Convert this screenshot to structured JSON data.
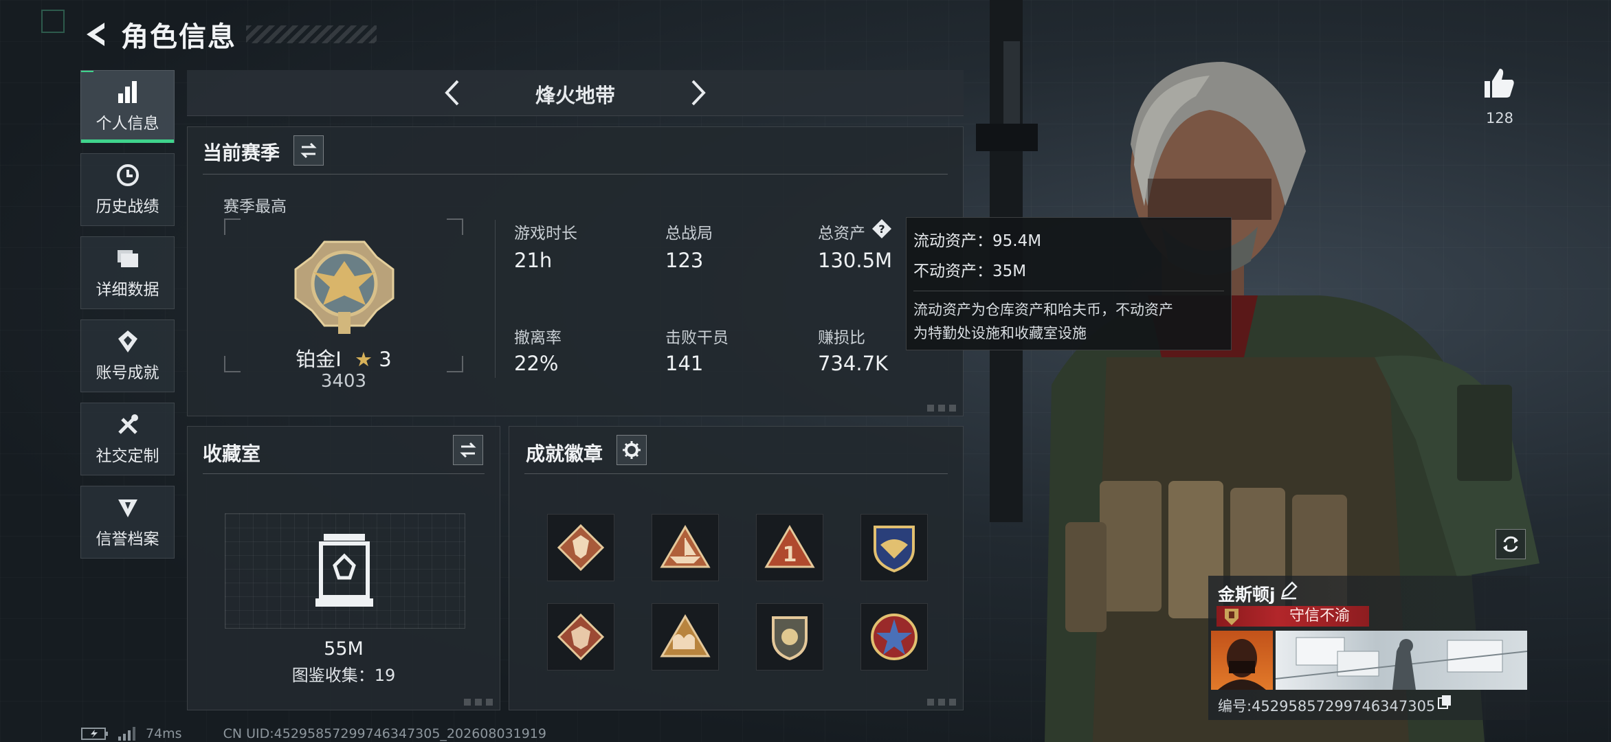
{
  "header": {
    "title": "角色信息"
  },
  "sidebar": {
    "items": [
      {
        "label": "个人信息",
        "icon": "bar-chart-icon",
        "active": true
      },
      {
        "label": "历史战绩",
        "icon": "history-clock-icon",
        "active": false
      },
      {
        "label": "详细数据",
        "icon": "folder-icon",
        "active": false
      },
      {
        "label": "账号成就",
        "icon": "achievement-icon",
        "active": false
      },
      {
        "label": "社交定制",
        "icon": "tools-icon",
        "active": false
      },
      {
        "label": "信誉档案",
        "icon": "credit-shield-icon",
        "active": false
      }
    ]
  },
  "mode": {
    "title": "烽火地带"
  },
  "season": {
    "title": "当前赛季",
    "highest_label": "赛季最高",
    "rank_name": "铂金Ⅰ",
    "rank_stars": "3",
    "rank_score": "3403",
    "stats": [
      {
        "label": "游戏时长",
        "value": "21h"
      },
      {
        "label": "总战局",
        "value": "123"
      },
      {
        "label": "总资产",
        "value": "130.5M"
      },
      {
        "label": "撤离率",
        "value": "22%"
      },
      {
        "label": "击败干员",
        "value": "141"
      },
      {
        "label": "赚损比",
        "value": "734.7K"
      }
    ]
  },
  "tooltip": {
    "liquid": "流动资产：95.4M",
    "fixed": "不动资产：35M",
    "desc_line1": "流动资产为仓库资产和哈夫币，不动资产",
    "desc_line2": "为特勤处设施和收藏室设施"
  },
  "collection": {
    "title": "收藏室",
    "value": "55M",
    "catalog": "图鉴收集：19"
  },
  "badges": {
    "title": "成就徽章",
    "items": [
      "wolf-badge-icon",
      "boat-badge-icon",
      "number-one-badge-icon",
      "eagle-shield-badge-icon",
      "dragon-badge-icon",
      "camel-badge-icon",
      "shield-badge-icon",
      "star-cross-badge-icon"
    ]
  },
  "player": {
    "likes": "128",
    "name": "金斯顿j",
    "title_badge": "守信不渝",
    "id": "编号:4529585729974634730​5"
  },
  "footer": {
    "ping": "74ms",
    "uid": "CN UID:452958572997463473​05_202608031919"
  },
  "colors": {
    "accent": "#3fd38c",
    "title_badge": "#b2262a",
    "gold": "#c9a45a"
  }
}
